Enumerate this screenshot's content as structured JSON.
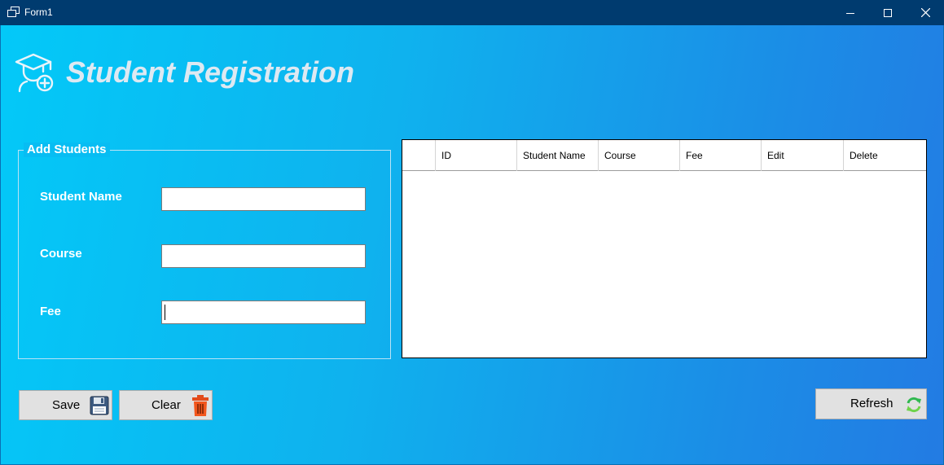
{
  "window": {
    "title": "Form1",
    "controls": [
      "minimize-icon",
      "maximize-icon",
      "close-icon"
    ]
  },
  "header": {
    "title": "Student Registration",
    "icon": "graduate-add-icon"
  },
  "form": {
    "legend": "Add Students",
    "student_name_label": "Student Name",
    "student_name_value": "",
    "course_label": "Course",
    "course_value": "",
    "fee_label": "Fee",
    "fee_value": ""
  },
  "grid": {
    "columns": [
      "ID",
      "Student Name",
      "Course",
      "Fee",
      "Edit",
      "Delete"
    ],
    "rows": []
  },
  "buttons": {
    "save_label": "Save",
    "save_icon": "floppy-disk-icon",
    "clear_label": "Clear",
    "clear_icon": "trash-icon",
    "refresh_label": "Refresh",
    "refresh_icon": "refresh-icon"
  },
  "colors": {
    "titlebar": "#003b6f",
    "gradient_start": "#03c9f8",
    "gradient_end": "#237be3",
    "button_face": "#e1e1e1"
  }
}
